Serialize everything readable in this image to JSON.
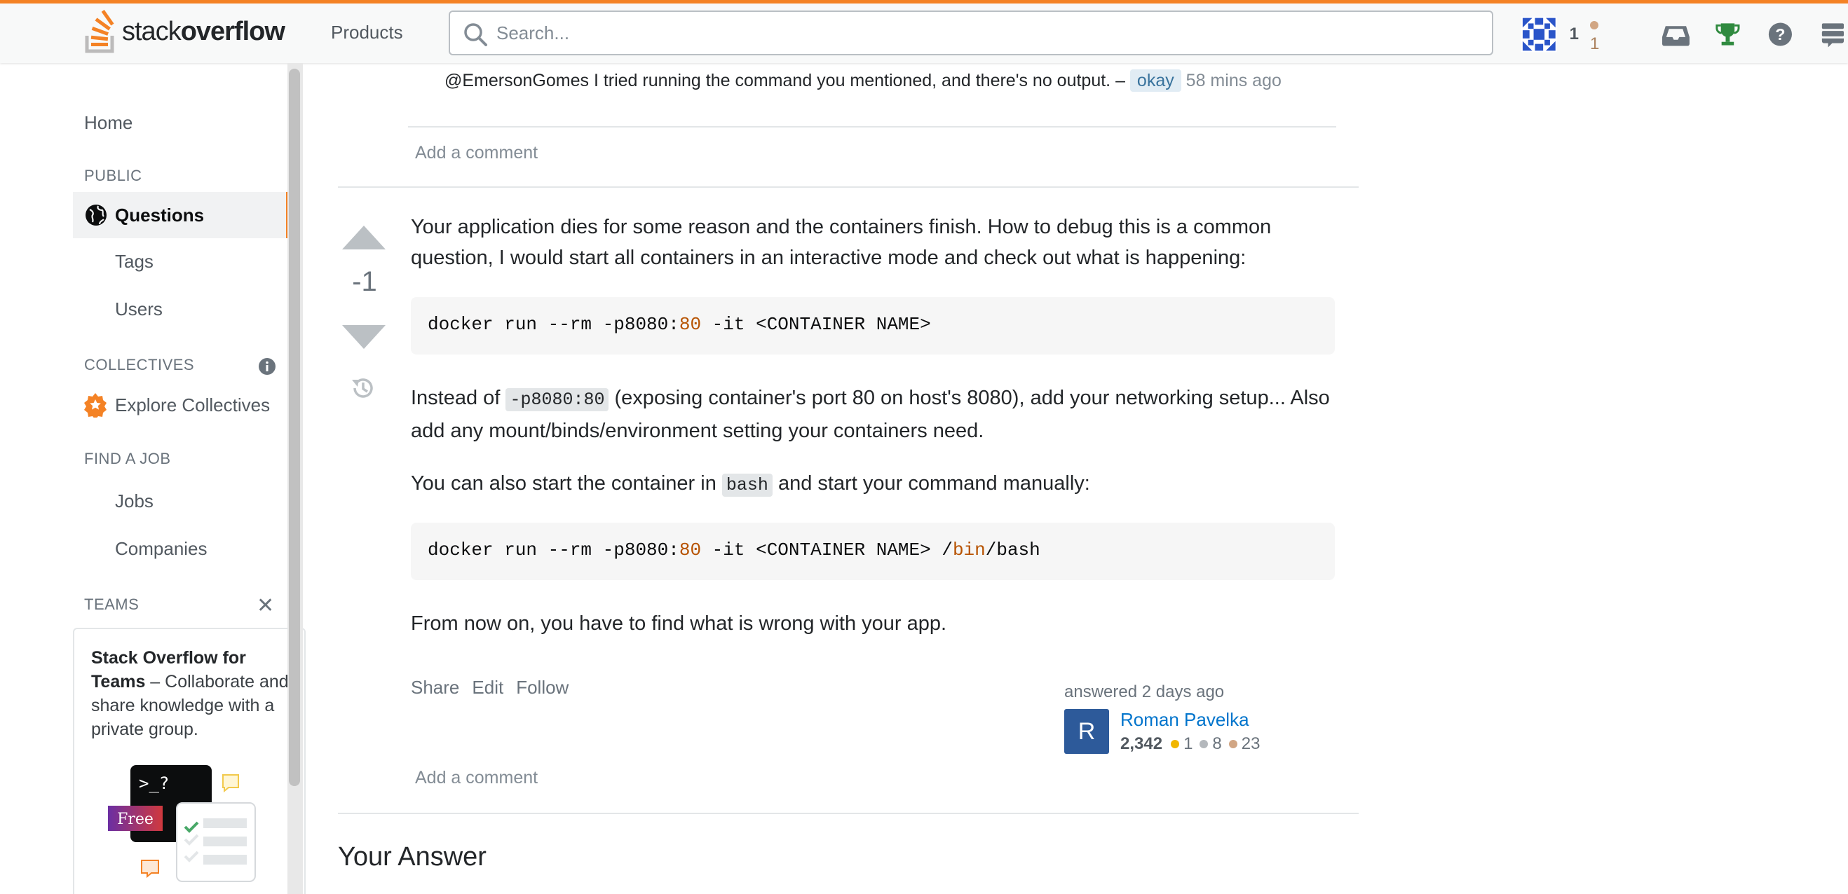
{
  "topbar": {
    "logo_text_light": "stack",
    "logo_text_bold": "overflow",
    "products_label": "Products",
    "search_placeholder": "Search...",
    "reputation": "1",
    "bronze_badges": "1",
    "icons": [
      "stackoverflow-logo-icon",
      "search-icon",
      "user-avatar-icon",
      "inbox-icon",
      "achievements-icon",
      "help-icon",
      "site-switcher-icon"
    ],
    "accent_color": "#f48225"
  },
  "sidebar": {
    "home": "Home",
    "public_heading": "PUBLIC",
    "questions": "Questions",
    "tags": "Tags",
    "users": "Users",
    "collectives_heading": "COLLECTIVES",
    "explore_collectives": "Explore Collectives",
    "find_job_heading": "FIND A JOB",
    "jobs": "Jobs",
    "companies": "Companies",
    "teams_heading": "TEAMS",
    "teams_title": "Stack Overflow for Teams",
    "teams_text": " – Collaborate and share knowledge with a private group.",
    "free_badge": "Free",
    "terminal_text": ">_?"
  },
  "comment": {
    "text": "@EmersonGomes I tried running the command you mentioned, and there's no output. – ",
    "author": "okay",
    "time": " 58 mins ago",
    "add_comment_top": "Add a comment"
  },
  "answer": {
    "vote_count": "-1",
    "para1": "Your application dies for some reason and the containers finish. How to debug this is a common question, I would start all containers in an interactive mode and check out what is happening:",
    "code1_pre": "docker run --rm -p8080:",
    "code1_lit": "80",
    "code1_post": " -it <CONTAINER NAME>",
    "para2_a": "Instead of ",
    "para2_code": "-p8080:80",
    "para2_b": " (exposing container's port 80 on host's 8080), add your networking setup... Also add any mount/binds/environment setting your containers need.",
    "para3_a": "You can also start the container in ",
    "para3_code": "bash",
    "para3_b": " and start your command manually:",
    "code2_pre": "docker run --rm -p8080:",
    "code2_lit": "80",
    "code2_mid": " -it <CONTAINER NAME> /",
    "code2_lit2": "bin",
    "code2_post": "/bash",
    "para4": "From now on, you have to find what is wrong with your app.",
    "share": "Share",
    "edit": "Edit",
    "follow": "Follow",
    "answered_label": "answered 2 days ago",
    "user_initial": "R",
    "user_name": "Roman Pavelka",
    "user_rep": "2,342",
    "gold": "1",
    "silver": "8",
    "bronze": "23",
    "add_comment": "Add a comment"
  },
  "your_answer_heading": "Your Answer"
}
